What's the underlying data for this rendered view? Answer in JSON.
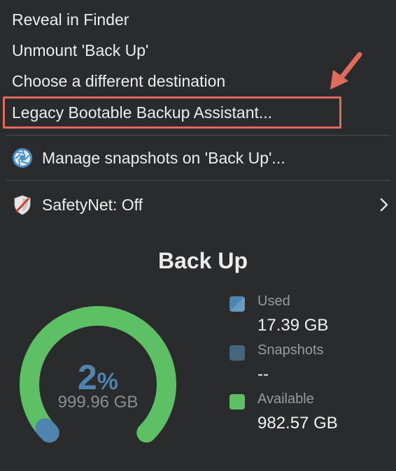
{
  "menu": {
    "items": [
      {
        "label": "Reveal in Finder"
      },
      {
        "label": "Unmount 'Back Up'"
      },
      {
        "label": "Choose a different destination"
      },
      {
        "label": "Legacy Bootable Backup Assistant..."
      },
      {
        "label": "Manage snapshots on 'Back Up'...",
        "icon": "aperture-icon"
      },
      {
        "label": "SafetyNet: Off",
        "icon": "shield-off-icon",
        "has_submenu": true
      }
    ]
  },
  "volume": {
    "title": "Back Up",
    "percent_used": "2",
    "percent_sign": "%",
    "capacity": "999.96 GB",
    "used_fraction": 0.02,
    "legend": [
      {
        "label": "Used",
        "value": "17.39 GB",
        "color": "#4e84ad"
      },
      {
        "label": "Snapshots",
        "value": "--",
        "color": "#46657f"
      },
      {
        "label": "Available",
        "value": "982.57 GB",
        "color": "#5ec064"
      }
    ]
  },
  "colors": {
    "background": "#2a2b2d",
    "highlight_box": "#e06a5c",
    "annotation_arrow": "#e06a5c",
    "gauge_available": "#5ec064",
    "gauge_used": "#4e84ad"
  }
}
